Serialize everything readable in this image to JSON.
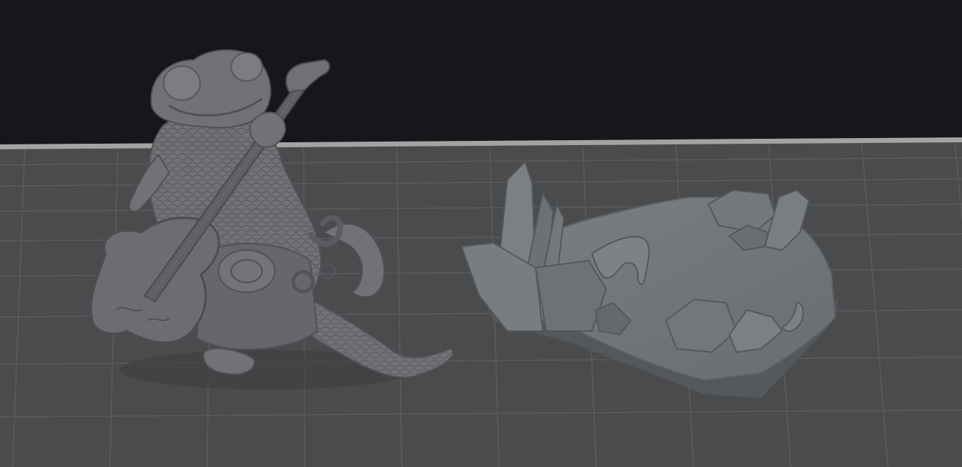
{
  "scene": {
    "background_color": "#16171a",
    "build_plate": {
      "plate_color": "#4a4b4d",
      "edge_color": "#a3a3a3",
      "grid_color": "#5b5c5e",
      "grid_visible": true
    },
    "models": [
      {
        "name": "lizard-guitarist-miniature",
        "color": "#707275"
      },
      {
        "name": "rocky-base-with-crystals",
        "color": "#6f7275"
      }
    ]
  }
}
